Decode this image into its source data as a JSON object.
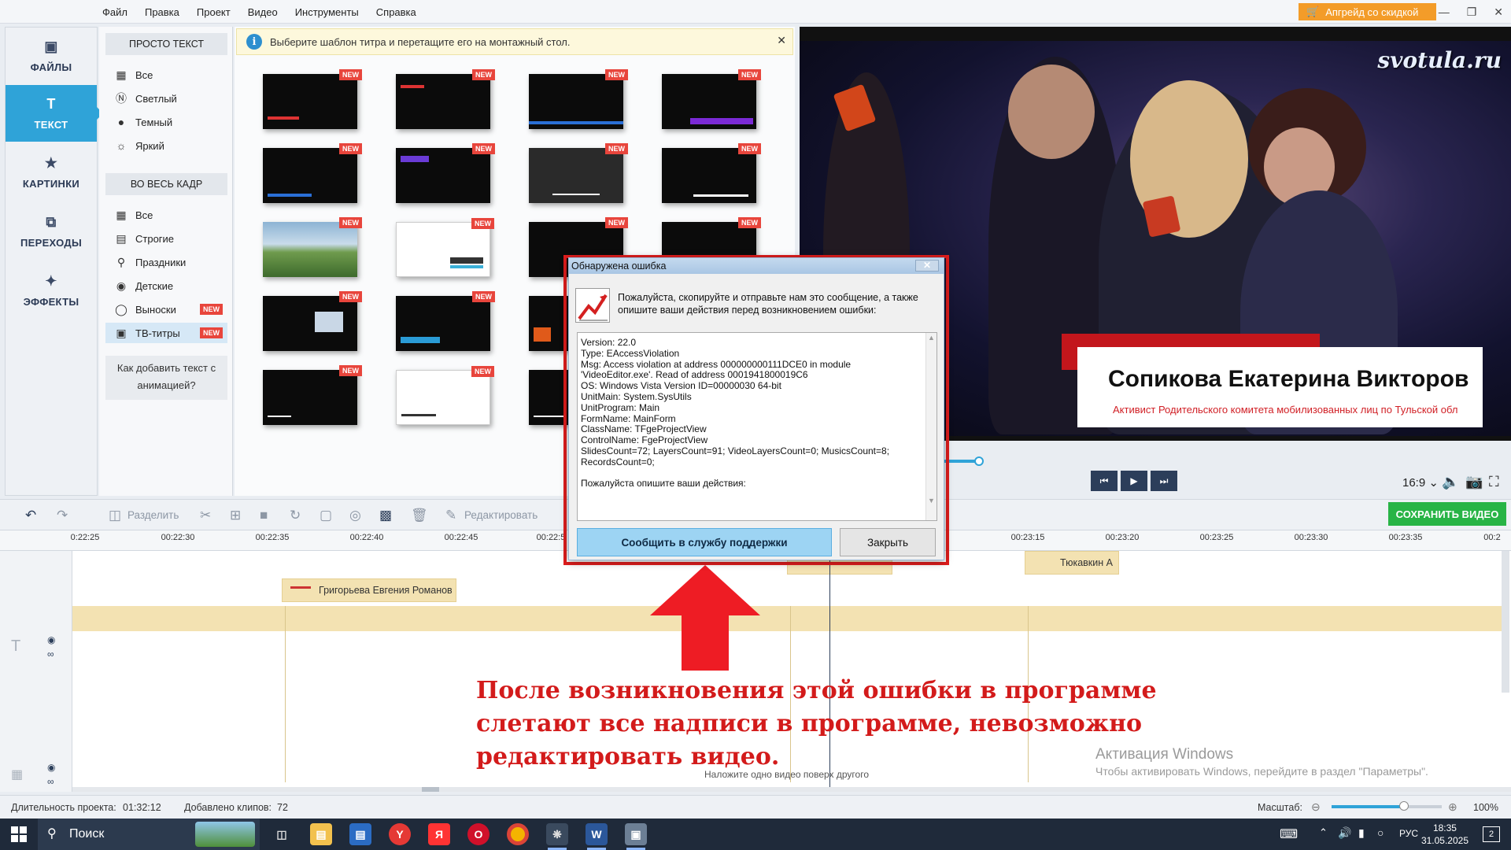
{
  "menu": [
    "Файл",
    "Правка",
    "Проект",
    "Видео",
    "Инструменты",
    "Справка"
  ],
  "upgrade_label": "Апгрейд со скидкой",
  "nav": [
    {
      "label": "ФАЙЛЫ",
      "icon": "image-icon"
    },
    {
      "label": "ТЕКСТ",
      "icon": "text-icon"
    },
    {
      "label": "КАРТИНКИ",
      "icon": "star-icon"
    },
    {
      "label": "ПЕРЕХОДЫ",
      "icon": "transitions-icon"
    },
    {
      "label": "ЭФФЕКТЫ",
      "icon": "magic-wand-icon"
    }
  ],
  "categories": {
    "group1_title": "ПРОСТО ТЕКСТ",
    "group1": [
      "Все",
      "Светлый",
      "Темный",
      "Яркий"
    ],
    "group2_title": "ВО ВЕСЬ КАДР",
    "group2": [
      "Все",
      "Строгие",
      "Праздники",
      "Детские",
      "Выноски",
      "ТВ-титры"
    ],
    "new_badge": "NEW",
    "howto": "Как добавить текст с анимацией?"
  },
  "info_message": "Выберите шаблон титра и перетащите его на монтажный стол.",
  "thumb_badge": "NEW",
  "preview": {
    "watermark": "svotula.ru",
    "title_name": "Сопикова Екатерина Викторов",
    "title_sub": "Активист Родительского комитета мобилизованных лиц по Тульской обл",
    "aspect_ratio": "16:9"
  },
  "toolbar": {
    "split_label": "Разделить",
    "edit_label": "Редактировать",
    "save_label": "СОХРАНИТЬ ВИДЕО"
  },
  "timeline": {
    "ticks": [
      "0:22:25",
      "00:22:30",
      "00:22:35",
      "00:22:40",
      "00:22:45",
      "00:22:5",
      "00:23:15",
      "00:23:20",
      "00:23:25",
      "00:23:30",
      "00:23:35",
      "00:2"
    ],
    "clips": [
      "Григорьева Евгения Романов",
      "Тюкавкин А"
    ],
    "hint": "Наложите одно видео поверх другого"
  },
  "status": {
    "duration_label": "Длительность проекта:",
    "duration_value": "01:32:12",
    "clips_label": "Добавлено клипов:",
    "clips_value": "72",
    "zoom_label": "Масштаб:",
    "zoom_value": "100%",
    "zoom_level": 0.66
  },
  "windows_activation": {
    "title": "Активация Windows",
    "text": "Чтобы активировать Windows, перейдите в раздел \"Параметры\"."
  },
  "annotation": "После возникновения этой ошибки в программе слетают все надписи в программе, невозможно редактировать видео.",
  "dialog": {
    "title": "Обнаружена ошибка",
    "message": "Пожалуйста, скопируйте и отправьте нам это сообщение, а также опишите ваши действия перед возникновением ошибки:",
    "details": [
      "Version: 22.0",
      "Type: EAccessViolation",
      "Msg: Access violation at address 000000000111DCE0 in module",
      "'VideoEditor.exe'. Read of address 0001941800019C6",
      "OS: Windows Vista Version ID=00000030 64-bit",
      "UnitMain: System.SysUtils",
      "UnitProgram: Main",
      "FormName: MainForm",
      "ClassName: TFgeProjectView",
      "ControlName: FgeProjectView",
      "SlidesCount=72; LayersCount=91; VideoLayersCount=0; MusicsCount=8;",
      "RecordsCount=0;",
      "",
      "Пожалуйста опишите ваши действия:"
    ],
    "report_button": "Сообщить в службу поддержки",
    "close_button": "Закрыть"
  },
  "taskbar": {
    "search_label": "Поиск",
    "lang": "РУС",
    "time": "18:35",
    "date": "31.05.2025",
    "notifications": "2"
  },
  "colors": {
    "accent": "#2fa3d8",
    "save": "#28b446",
    "upgrade": "#f39c29",
    "alert_red": "#e21d1d",
    "new_badge": "#e8453c"
  }
}
